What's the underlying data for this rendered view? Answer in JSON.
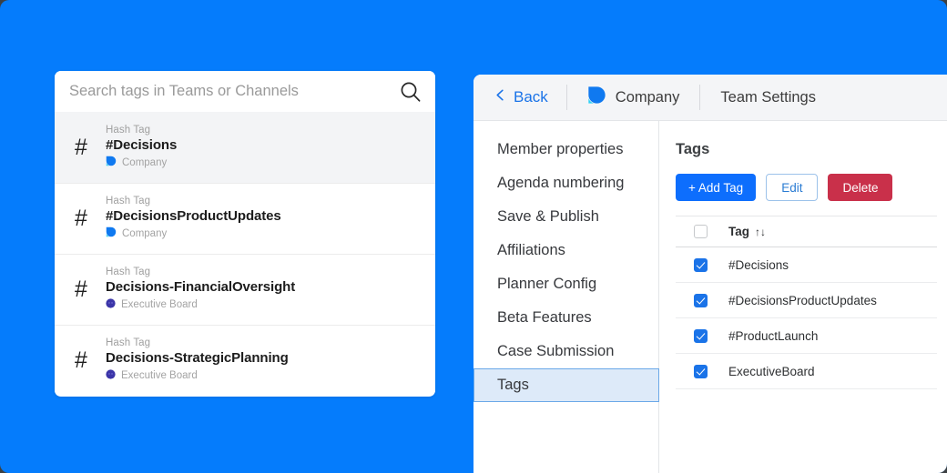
{
  "theme": {
    "background": "#057cfc",
    "panel": "#ffffff",
    "accent_blue": "#0d6efd",
    "link_blue": "#1a73e8",
    "danger_red": "#c9304a",
    "selected_nav_bg": "#ddeaf9",
    "selected_row_bg": "#f3f4f6",
    "board_purple": "#3b35a8"
  },
  "search_panel": {
    "search": {
      "placeholder": "Search tags in Teams or Channels",
      "value": "",
      "icon": "search-icon"
    },
    "results": [
      {
        "hash": "#",
        "kind": "Hash Tag",
        "title": "#Decisions",
        "meta_label": "Company",
        "meta_icon": "company-droplet-icon",
        "selected": true
      },
      {
        "hash": "#",
        "kind": "Hash Tag",
        "title": "#DecisionsProductUpdates",
        "meta_label": "Company",
        "meta_icon": "company-droplet-icon",
        "selected": false
      },
      {
        "hash": "#",
        "kind": "Hash Tag",
        "title": "Decisions-FinancialOversight",
        "meta_label": "Executive Board",
        "meta_icon": "executive-board-avatar-icon",
        "selected": false
      },
      {
        "hash": "#",
        "kind": "Hash Tag",
        "title": "Decisions-StrategicPlanning",
        "meta_label": "Executive Board",
        "meta_icon": "executive-board-avatar-icon",
        "selected": false
      }
    ]
  },
  "settings_panel": {
    "header": {
      "back_label": "Back",
      "back_icon": "chevron-left-icon",
      "company_label": "Company",
      "company_icon": "company-droplet-icon",
      "title": "Team Settings"
    },
    "nav_items": [
      {
        "label": "Member properties",
        "active": false
      },
      {
        "label": "Agenda numbering",
        "active": false
      },
      {
        "label": "Save & Publish",
        "active": false
      },
      {
        "label": "Affiliations",
        "active": false
      },
      {
        "label": "Planner Config",
        "active": false
      },
      {
        "label": "Beta Features",
        "active": false
      },
      {
        "label": "Case Submission",
        "active": false
      },
      {
        "label": "Tags",
        "active": true
      }
    ],
    "content": {
      "title": "Tags",
      "buttons": {
        "add": "+ Add Tag",
        "edit": "Edit",
        "delete": "Delete"
      },
      "table": {
        "select_all_checked": false,
        "column_header": "Tag",
        "sort_glyph": "↑↓",
        "rows": [
          {
            "label": "#Decisions",
            "checked": true
          },
          {
            "label": "#DecisionsProductUpdates",
            "checked": true
          },
          {
            "label": "#ProductLaunch",
            "checked": true
          },
          {
            "label": "ExecutiveBoard",
            "checked": true
          }
        ]
      }
    }
  }
}
